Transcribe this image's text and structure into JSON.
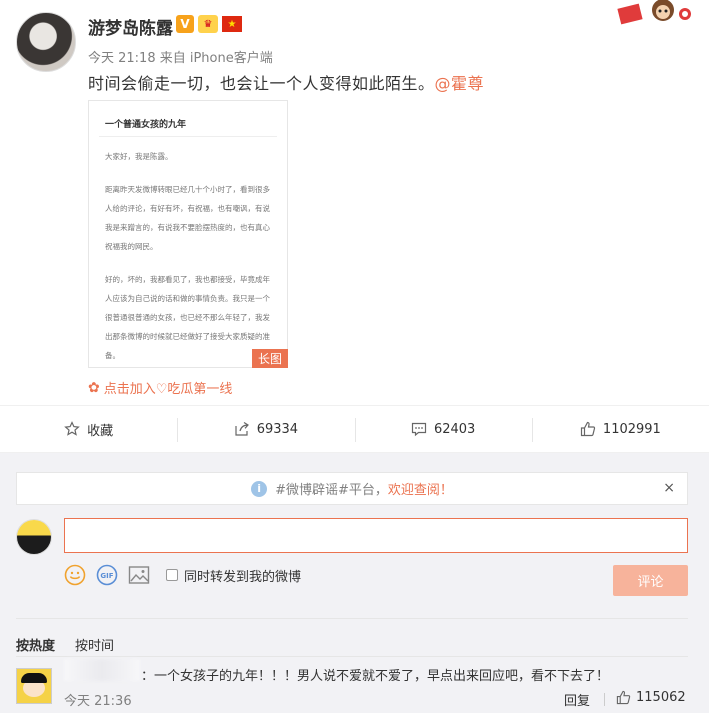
{
  "post": {
    "author": "游梦岛陈露",
    "badge_v": "V",
    "meta": "今天 21:18 来自 iPhone客户端",
    "text": "时间会偷走一切，也会让一个人变得如此陌生。",
    "mention": "@霍尊",
    "long_image": {
      "title": "一个普通女孩的九年",
      "paragraphs": [
        "大家好，我是陈露。",
        "距离昨天发微博转眼已经几十个小时了，看到很多人给的评论，有好有坏，有祝福，也有嘲讽，有说我是来蹭言的，有说我不要脸摆热度的，也有真心祝福我的网民。",
        "好的，坏的，我都看见了，我也都接受，毕竟成年人应该为自己说的话和做的事情负责。我只是一个很普通很普通的女孩，也已经不那么年轻了，我发出那条微博的时候就已经做好了接受大家质疑的准备。"
      ],
      "tag": "长图"
    },
    "join_link": "点击加入♡吃瓜第一线"
  },
  "actions": {
    "favorite": "收藏",
    "repost": "69334",
    "comment": "62403",
    "like": "1102991"
  },
  "comment_box": {
    "notice_prefix": "#微博辟谣#平台，",
    "notice_highlight": "欢迎查阅！",
    "notice_close": "×",
    "input_value": "",
    "repost_label": "同时转发到我的微博",
    "submit_label": "评论"
  },
  "sort": {
    "hot": "按热度",
    "time": "按时间"
  },
  "comments": [
    {
      "text": "：一个女孩子的九年！！！男人说不爱就不爱了，早点出来回应吧，看不下去了！",
      "time": "今天 21:36",
      "reply": "回复",
      "likes": "115062"
    }
  ],
  "colors": {
    "accent": "#eb7350",
    "muted": "#808080",
    "panel_bg": "#f2f2f5"
  }
}
